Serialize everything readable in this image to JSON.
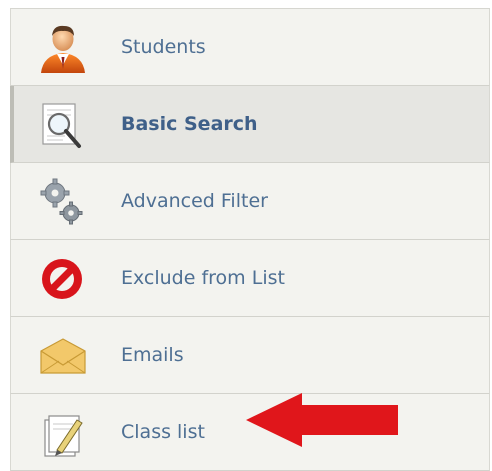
{
  "menu": {
    "items": [
      {
        "label": "Students",
        "icon": "student-person-icon",
        "active": false
      },
      {
        "label": "Basic Search",
        "icon": "magnifier-document-icon",
        "active": true
      },
      {
        "label": "Advanced Filter",
        "icon": "gears-icon",
        "active": false
      },
      {
        "label": "Exclude from List",
        "icon": "no-entry-icon",
        "active": false
      },
      {
        "label": "Emails",
        "icon": "envelope-icon",
        "active": false
      },
      {
        "label": "Class list",
        "icon": "pencil-paper-icon",
        "active": false
      }
    ]
  },
  "annotation": {
    "type": "arrow",
    "color": "#e0161b",
    "points_to": "Class list"
  },
  "colors": {
    "label": "#4e6f93",
    "active_label": "#3f6089",
    "item_bg": "#f3f3ef",
    "active_bg": "#e6e6e2"
  }
}
